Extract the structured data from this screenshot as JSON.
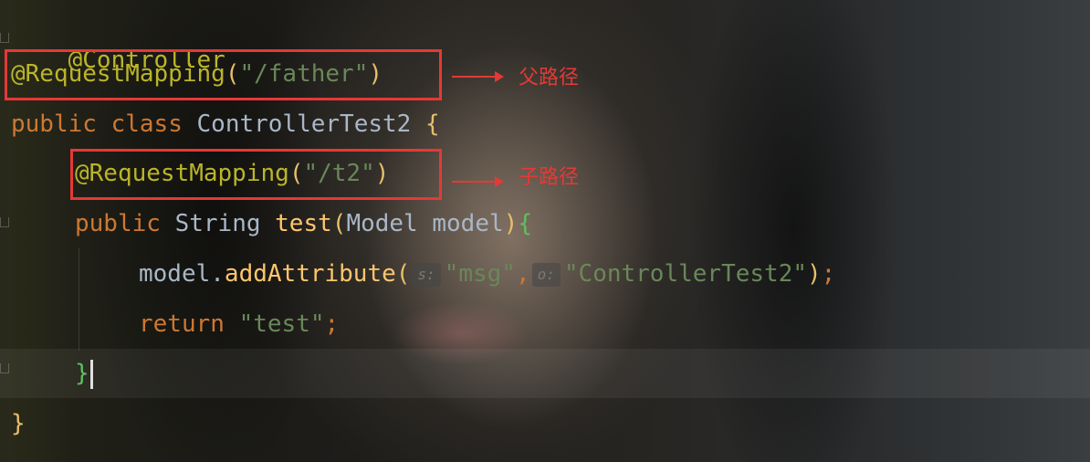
{
  "code": {
    "line1": {
      "annotation": "@Controller"
    },
    "line2": {
      "annotation": "@RequestMapping",
      "open": "(",
      "string": "\"/father\"",
      "close": ")"
    },
    "line3": {
      "kw1": "public",
      "kw2": "class",
      "classname": "ControllerTest2",
      "brace": "{"
    },
    "line4": {
      "annotation": "@RequestMapping",
      "open": "(",
      "string": "\"/t2\"",
      "close": ")"
    },
    "line5": {
      "kw": "public",
      "type": "String",
      "method": "test",
      "open": "(",
      "paramtype": "Model",
      "param": "model",
      "close": ")",
      "brace": "{"
    },
    "line6": {
      "object": "model.",
      "method": "addAttribute",
      "open": "(",
      "hint1": "s:",
      "string1": "\"msg\"",
      "comma": ",",
      "hint2": "o:",
      "string2": "\"ControllerTest2\"",
      "close": ")",
      "semi": ";"
    },
    "line7": {
      "kw": "return",
      "string": "\"test\"",
      "semi": ";"
    },
    "line8": {
      "brace": "}"
    },
    "line9": {
      "brace": "}"
    }
  },
  "annotations": {
    "parent_path_label": "父路径",
    "child_path_label": "子路径",
    "box_color": "#e53935"
  }
}
